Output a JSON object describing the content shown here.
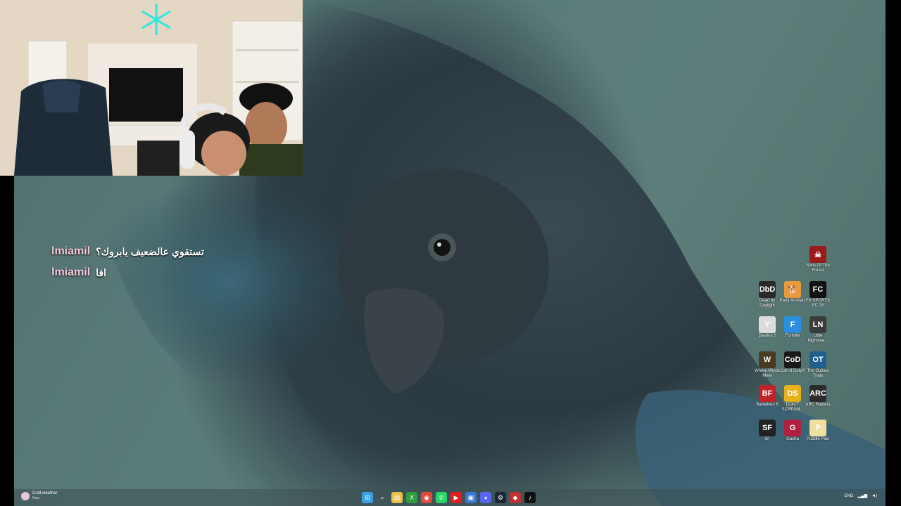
{
  "chat": {
    "messages": [
      {
        "user": "lmiamil",
        "text": "تستقوي عالضعيف يابروك؟"
      },
      {
        "user": "lmiamil",
        "text": "افا"
      }
    ]
  },
  "desktop_icons": [
    {
      "label": "Sons Of The Forest",
      "color": "#9b1b1b",
      "glyph": "☠"
    },
    {
      "label": "Dead by Daylight",
      "color": "#2a2a2a",
      "glyph": "DbD"
    },
    {
      "label": "Party Animals",
      "color": "#e89a3a",
      "glyph": "🐕"
    },
    {
      "label": "EA SPORTS FC 26",
      "color": "#111111",
      "glyph": "FC"
    },
    {
      "label": "Destiny 2",
      "color": "#dcdcdc",
      "glyph": "Y"
    },
    {
      "label": "Fortnite",
      "color": "#2a8fdc",
      "glyph": "F"
    },
    {
      "label": "Little Nightmar...",
      "color": "#3b3b3b",
      "glyph": "LN"
    },
    {
      "label": "Where Winds Meet",
      "color": "#4a3a22",
      "glyph": "W"
    },
    {
      "label": "Call of Duty®",
      "color": "#1a1a1a",
      "glyph": "CoD"
    },
    {
      "label": "The Outlast Trials",
      "color": "#1f5f8f",
      "glyph": "OT"
    },
    {
      "label": "Battlefield 6",
      "color": "#c0242a",
      "glyph": "BF"
    },
    {
      "label": "DON'T SCREAM...",
      "color": "#e8b21a",
      "glyph": "DS"
    },
    {
      "label": "ARC Raiders",
      "color": "#2c2c2c",
      "glyph": "ARC"
    },
    {
      "label": "SF",
      "color": "#222222",
      "glyph": "SF"
    },
    {
      "label": "Gacha",
      "color": "#b02040",
      "glyph": "G"
    },
    {
      "label": "Puddle Pals",
      "color": "#f0e0a0",
      "glyph": "P"
    }
  ],
  "taskbar": {
    "weather_title": "Cold weather",
    "weather_sub": "Now",
    "apps": [
      {
        "name": "windows-start-icon",
        "glyph": "⊞",
        "color": "#3aa0e8"
      },
      {
        "name": "search-icon",
        "glyph": "⌕",
        "color": "transparent"
      },
      {
        "name": "file-explorer-icon",
        "glyph": "▤",
        "color": "#e8c24a"
      },
      {
        "name": "xbox-icon",
        "glyph": "X",
        "color": "#2e9e3e"
      },
      {
        "name": "chrome-icon",
        "glyph": "◉",
        "color": "#e04a3a"
      },
      {
        "name": "whatsapp-icon",
        "glyph": "✆",
        "color": "#25d366"
      },
      {
        "name": "youtube-icon",
        "glyph": "▶",
        "color": "#e02020"
      },
      {
        "name": "store-icon",
        "glyph": "▣",
        "color": "#3a78d8"
      },
      {
        "name": "discord-icon",
        "glyph": "◕",
        "color": "#5865f2"
      },
      {
        "name": "steam-icon",
        "glyph": "⚙",
        "color": "#1b2838"
      },
      {
        "name": "app-icon",
        "glyph": "◆",
        "color": "#c03030"
      },
      {
        "name": "tiktok-icon",
        "glyph": "♪",
        "color": "#111111"
      }
    ],
    "tray_lang": "ENG"
  }
}
